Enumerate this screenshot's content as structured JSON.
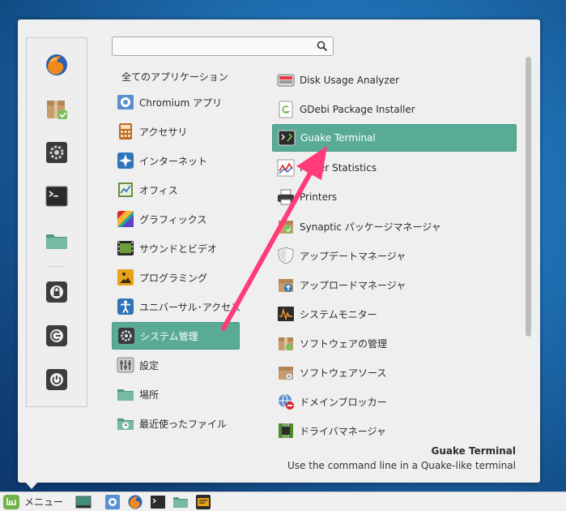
{
  "search": {
    "placeholder": "",
    "value": ""
  },
  "categories": {
    "all_label": "全てのアプリケーション",
    "items": [
      {
        "label": "Chromium アプリ",
        "icon": "chromium-app-icon"
      },
      {
        "label": "アクセサリ",
        "icon": "accessories-icon"
      },
      {
        "label": "インターネット",
        "icon": "internet-icon"
      },
      {
        "label": "オフィス",
        "icon": "office-icon"
      },
      {
        "label": "グラフィックス",
        "icon": "graphics-icon"
      },
      {
        "label": "サウンドとビデオ",
        "icon": "sound-video-icon"
      },
      {
        "label": "プログラミング",
        "icon": "programming-icon"
      },
      {
        "label": "ユニバーサル･アクセス",
        "icon": "universal-access-icon"
      },
      {
        "label": "システム管理",
        "icon": "system-admin-icon",
        "selected": true
      },
      {
        "label": "設定",
        "icon": "settings-icon"
      },
      {
        "label": "場所",
        "icon": "places-folder-icon"
      },
      {
        "label": "最近使ったファイル",
        "icon": "recent-files-icon"
      }
    ]
  },
  "apps": [
    {
      "label": "Disk Usage Analyzer",
      "icon": "disk-usage-icon"
    },
    {
      "label": "GDebi Package Installer",
      "icon": "gdebi-icon"
    },
    {
      "label": "Guake Terminal",
      "icon": "terminal-icon",
      "selected": true
    },
    {
      "label": "Power Statistics",
      "icon": "power-statistics-icon"
    },
    {
      "label": "Printers",
      "icon": "printer-icon"
    },
    {
      "label": "Synaptic パッケージマネージャ",
      "icon": "synaptic-icon"
    },
    {
      "label": "アップデートマネージャ",
      "icon": "shield-icon"
    },
    {
      "label": "アップロードマネージャ",
      "icon": "upload-manager-icon"
    },
    {
      "label": "システムモニター",
      "icon": "system-monitor-icon"
    },
    {
      "label": "ソフトウェアの管理",
      "icon": "software-manager-icon"
    },
    {
      "label": "ソフトウェアソース",
      "icon": "software-sources-icon"
    },
    {
      "label": "ドメインブロッカー",
      "icon": "domain-blocker-icon"
    },
    {
      "label": "ドライバマネージャ",
      "icon": "driver-manager-icon"
    }
  ],
  "description": {
    "title": "Guake Terminal",
    "text": "Use the command line in a Quake-like terminal"
  },
  "taskbar": {
    "menu_label": "メニュー"
  },
  "colors": {
    "selection": "#5aab96",
    "arrow": "#ff3c78",
    "menu_bg": "#efefef"
  }
}
